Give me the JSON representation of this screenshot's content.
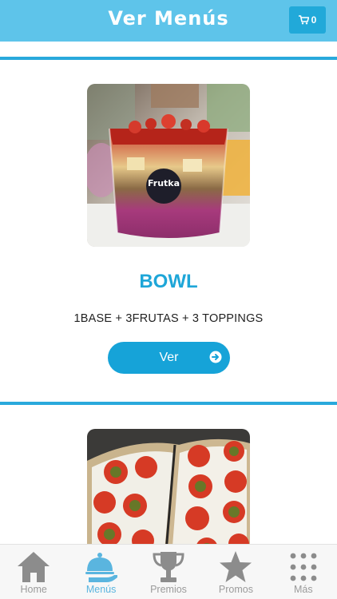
{
  "header": {
    "title": "Ver Menús",
    "cart_count": "0"
  },
  "menus": [
    {
      "title": "BOWL",
      "description": "1BASE + 3FRUTAS + 3 TOPPINGS",
      "button_label": "Ver",
      "image_brand": "Frutka"
    },
    {
      "title": "",
      "description": "",
      "button_label": ""
    }
  ],
  "tabbar": {
    "active_tab": "Menús",
    "items": [
      {
        "label": "Home",
        "icon": "home-icon"
      },
      {
        "label": "Menús",
        "icon": "food-cloche-icon"
      },
      {
        "label": "Premios",
        "icon": "trophy-icon"
      },
      {
        "label": "Promos",
        "icon": "star-icon"
      },
      {
        "label": "Más",
        "icon": "grid-dots-icon"
      }
    ]
  },
  "colors": {
    "header": "#5ec4ea",
    "accent": "#16a3d8",
    "divider": "#29a9dc",
    "tab_active": "#5ab5df",
    "tab_inactive": "#9b9b9b"
  }
}
